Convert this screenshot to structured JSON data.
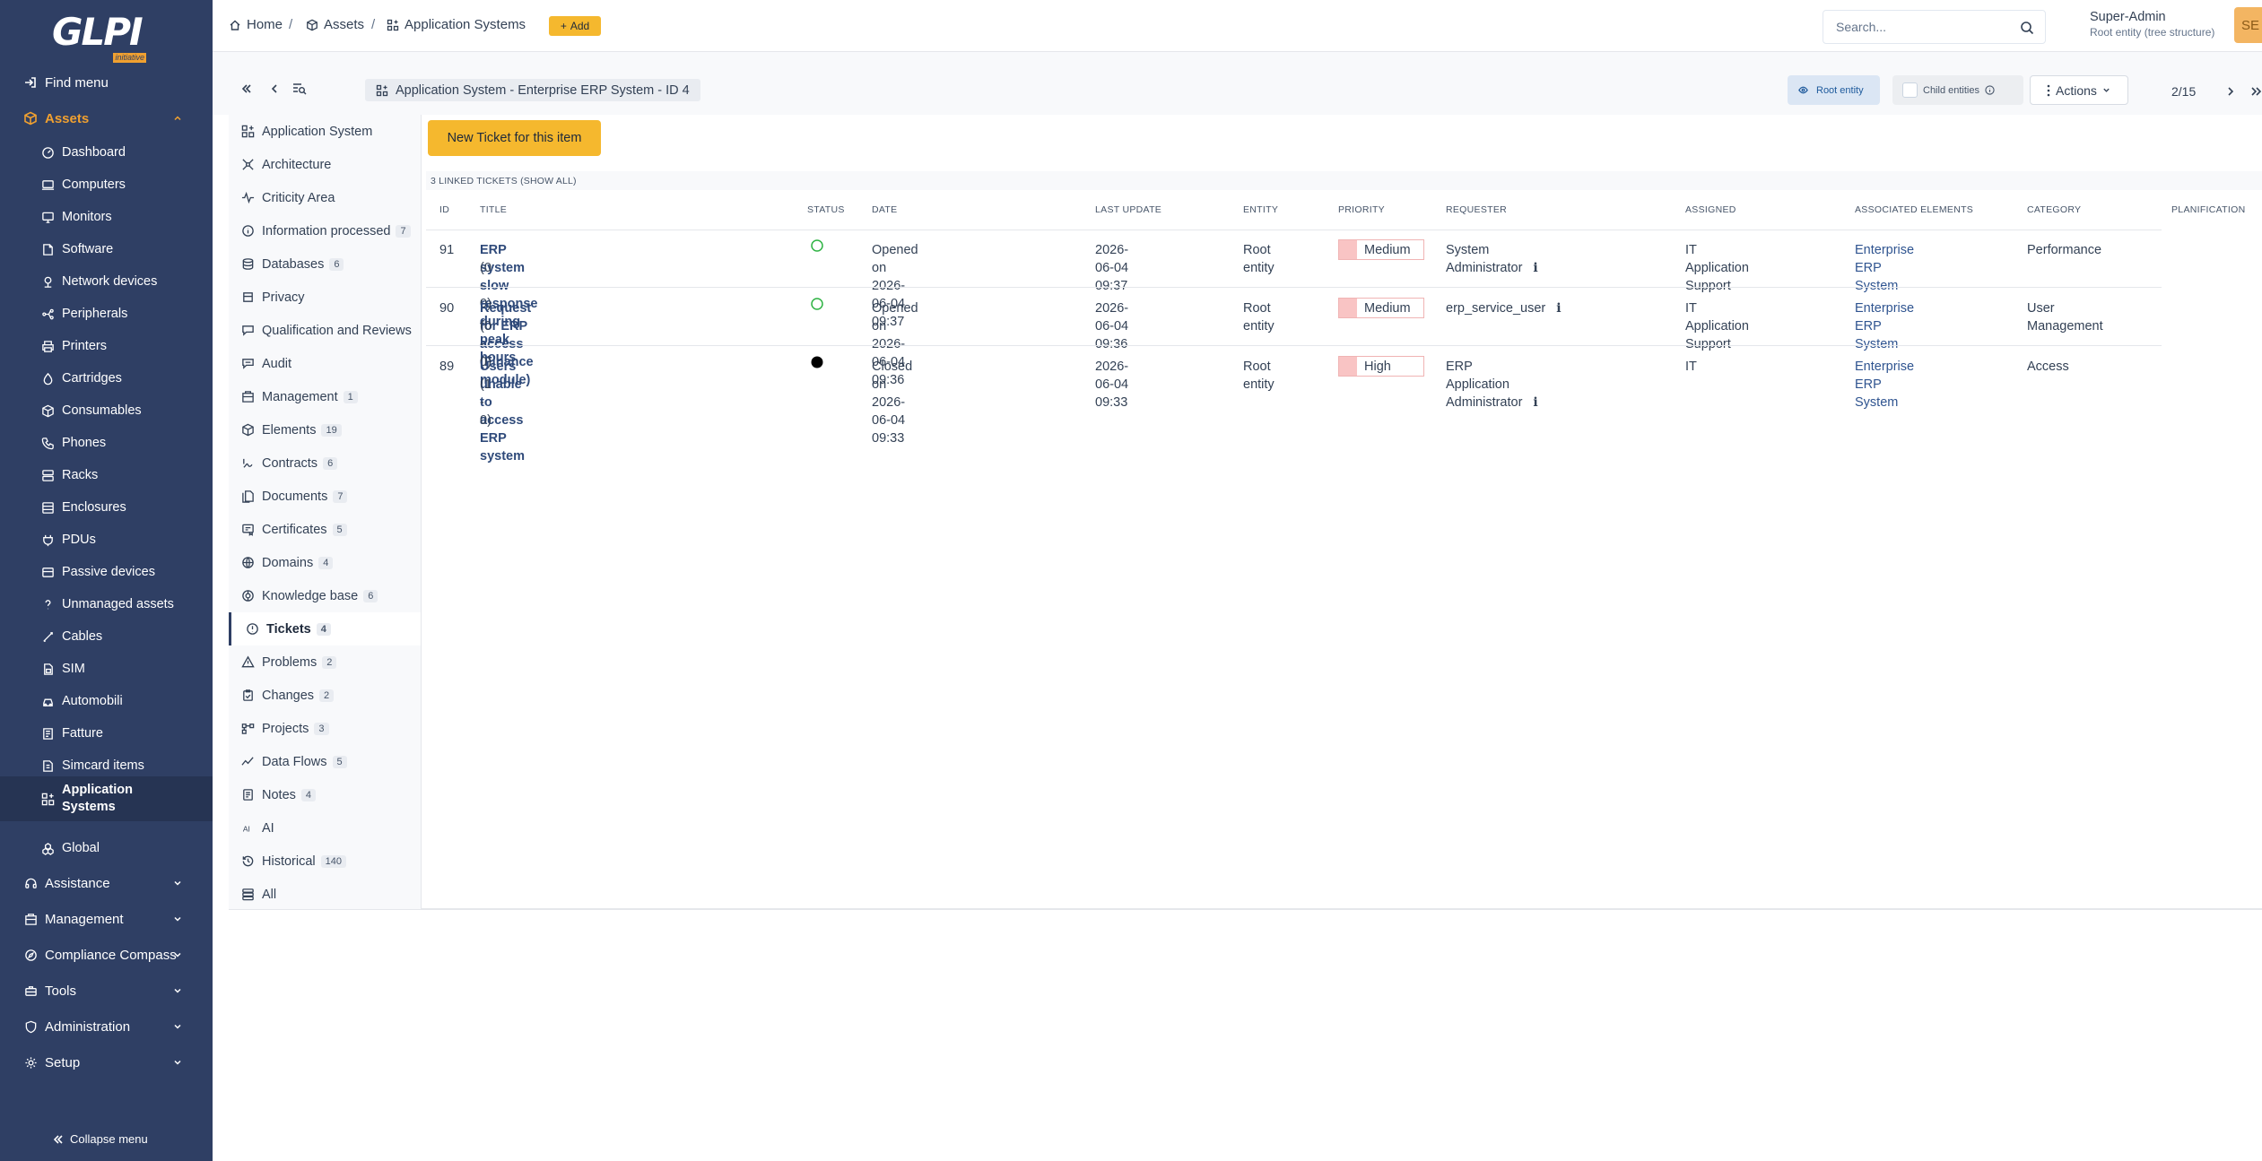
{
  "app": {
    "logo_text": "GLPI",
    "logo_tag": "initiative",
    "collapse_label": "Collapse menu"
  },
  "sidebar": {
    "find_menu": "Find menu",
    "assets": "Assets",
    "items": [
      {
        "label": "Dashboard",
        "icon": "dashboard-icon"
      },
      {
        "label": "Computers",
        "icon": "computer-icon"
      },
      {
        "label": "Monitors",
        "icon": "monitor-icon"
      },
      {
        "label": "Software",
        "icon": "software-icon"
      },
      {
        "label": "Network devices",
        "icon": "network-icon"
      },
      {
        "label": "Peripherals",
        "icon": "peripheral-icon"
      },
      {
        "label": "Printers",
        "icon": "printer-icon"
      },
      {
        "label": "Cartridges",
        "icon": "cartridge-icon"
      },
      {
        "label": "Consumables",
        "icon": "consumable-icon"
      },
      {
        "label": "Phones",
        "icon": "phone-icon"
      },
      {
        "label": "Racks",
        "icon": "rack-icon"
      },
      {
        "label": "Enclosures",
        "icon": "enclosure-icon"
      },
      {
        "label": "PDUs",
        "icon": "pdu-icon"
      },
      {
        "label": "Passive devices",
        "icon": "passive-device-icon"
      },
      {
        "label": "Unmanaged assets",
        "icon": "question-icon"
      },
      {
        "label": "Cables",
        "icon": "cable-icon"
      },
      {
        "label": "SIM",
        "icon": "sim-icon"
      },
      {
        "label": "Automobili",
        "icon": "car-icon"
      },
      {
        "label": "Fatture",
        "icon": "invoice-icon"
      },
      {
        "label": "Simcard items",
        "icon": "simcard-icon"
      },
      {
        "label": "Application Systems",
        "icon": "apps-icon"
      },
      {
        "label": "Global",
        "icon": "global-icon"
      }
    ],
    "sections": [
      "Assistance",
      "Management",
      "Compliance Compass",
      "Tools",
      "Administration",
      "Setup"
    ]
  },
  "topbar": {
    "breadcrumb": [
      "Home",
      "Assets",
      "Application Systems"
    ],
    "add_label": "Add",
    "search_placeholder": "Search...",
    "user_name": "Super-Admin",
    "user_entity": "Root entity (tree structure)",
    "avatar_initials": "SE"
  },
  "item_header": {
    "title": "Application System -  Enterprise ERP System - ID 4",
    "root_entity": "Root entity",
    "child_entities": "Child entities",
    "actions": "Actions",
    "pager": "2/15"
  },
  "tabs": [
    {
      "label": "Application System",
      "icon": "apps-icon"
    },
    {
      "label": "Architecture",
      "icon": "architecture-icon"
    },
    {
      "label": "Criticity Area",
      "icon": "pulse-icon"
    },
    {
      "label": "Information processed",
      "badge": "7",
      "icon": "info-icon"
    },
    {
      "label": "Databases",
      "badge": "6",
      "icon": "database-icon"
    },
    {
      "label": "Privacy",
      "icon": "privacy-icon"
    },
    {
      "label": "Qualification and Reviews",
      "icon": "review-icon"
    },
    {
      "label": "Audit",
      "icon": "audit-icon"
    },
    {
      "label": "Management",
      "badge": "1",
      "icon": "management-icon"
    },
    {
      "label": "Elements",
      "badge": "19",
      "icon": "box-icon"
    },
    {
      "label": "Contracts",
      "badge": "6",
      "icon": "contract-icon"
    },
    {
      "label": "Documents",
      "badge": "7",
      "icon": "document-icon"
    },
    {
      "label": "Certificates",
      "badge": "5",
      "icon": "certificate-icon"
    },
    {
      "label": "Domains",
      "badge": "4",
      "icon": "globe-icon"
    },
    {
      "label": "Knowledge base",
      "badge": "6",
      "icon": "knowledge-icon"
    },
    {
      "label": "Tickets",
      "badge": "4",
      "icon": "ticket-icon"
    },
    {
      "label": "Problems",
      "badge": "2",
      "icon": "warning-icon"
    },
    {
      "label": "Changes",
      "badge": "2",
      "icon": "clipboard-icon"
    },
    {
      "label": "Projects",
      "badge": "3",
      "icon": "project-icon"
    },
    {
      "label": "Data Flows",
      "badge": "5",
      "icon": "dataflow-icon"
    },
    {
      "label": "Notes",
      "badge": "4",
      "icon": "notes-icon"
    },
    {
      "label": "AI",
      "icon": "ai-icon"
    },
    {
      "label": "Historical",
      "badge": "140",
      "icon": "history-icon"
    },
    {
      "label": "All",
      "icon": "stack-icon"
    }
  ],
  "content": {
    "new_ticket": "New Ticket for this item",
    "linked_tickets": "3 LINKED TICKETS (SHOW ALL)",
    "columns": [
      "ID",
      "TITLE",
      "STATUS",
      "DATE",
      "LAST UPDATE",
      "ENTITY",
      "PRIORITY",
      "REQUESTER",
      "ASSIGNED",
      "ASSOCIATED ELEMENTS",
      "CATEGORY",
      "PLANIFICATION"
    ],
    "rows": [
      {
        "id": "91",
        "title": "ERP system slow response during peak hours",
        "counts": "(0 - 0)",
        "status": "new",
        "date": "Opened on 2026-06-04 09:37",
        "last_update": "2026-06-04 09:37",
        "entity": "Root entity",
        "priority": "Medium",
        "requester": "System Administrator",
        "assigned": "IT Application Support",
        "associated": "Enterprise ERP System",
        "category": "Performance"
      },
      {
        "id": "90",
        "title": "Request for ERP access (Finance module)",
        "counts": "(0 - 0)",
        "status": "new",
        "date": "Opened on 2026-06-04 09:36",
        "last_update": "2026-06-04 09:36",
        "entity": "Root entity",
        "priority": "Medium",
        "requester": "erp_service_user",
        "assigned": "IT Application Support",
        "associated": "Enterprise ERP System",
        "category": "User Management"
      },
      {
        "id": "89",
        "title": "Users unable to access ERP system",
        "counts": "(1 - 0)",
        "status": "closed",
        "date": "Closed on 2026-06-04 09:33",
        "last_update": "2026-06-04 09:33",
        "entity": "Root entity",
        "priority": "High",
        "requester": "ERP Application Administrator",
        "assigned": "IT",
        "associated": "Enterprise ERP System",
        "category": "Access"
      }
    ]
  },
  "colors": {
    "sidebar": "#2f3f64",
    "accent": "#f0a030",
    "button": "#f5b82e",
    "status_new": "#2fb344",
    "priority": "#f9c4c4"
  }
}
